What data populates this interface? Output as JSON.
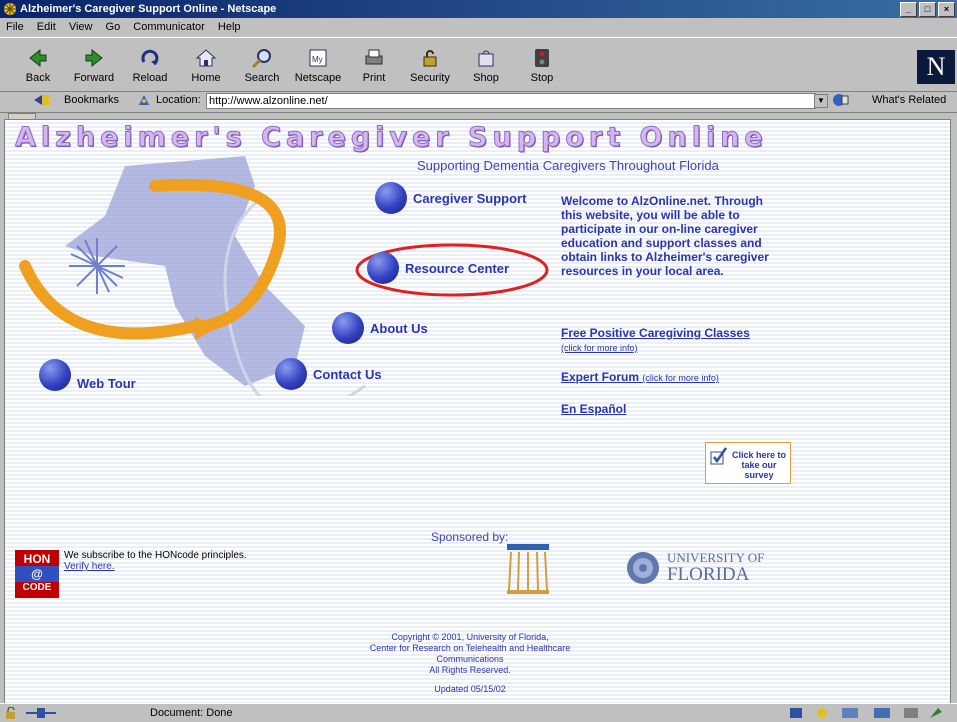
{
  "window": {
    "title": "Alzheimer's Caregiver Support Online - Netscape",
    "controls": {
      "minimize": "_",
      "maximize": "□",
      "close": "×"
    }
  },
  "menu": [
    "File",
    "Edit",
    "View",
    "Go",
    "Communicator",
    "Help"
  ],
  "toolbar": [
    {
      "label": "Back",
      "icon": "back-arrow-icon"
    },
    {
      "label": "Forward",
      "icon": "forward-arrow-icon"
    },
    {
      "label": "Reload",
      "icon": "reload-icon"
    },
    {
      "label": "Home",
      "icon": "home-icon"
    },
    {
      "label": "Search",
      "icon": "search-icon"
    },
    {
      "label": "Netscape",
      "icon": "netscape-icon"
    },
    {
      "label": "Print",
      "icon": "print-icon"
    },
    {
      "label": "Security",
      "icon": "lock-icon"
    },
    {
      "label": "Shop",
      "icon": "shop-icon"
    },
    {
      "label": "Stop",
      "icon": "stop-icon"
    }
  ],
  "location": {
    "bookmarks_label": "Bookmarks",
    "location_label": "Location:",
    "url": "http://www.alzonline.net/",
    "whats_related": "What's Related"
  },
  "page": {
    "site_title": "Alzheimer's Caregiver Support Online",
    "subtitle": "Supporting Dementia Caregivers Throughout Florida",
    "nav": {
      "caregiver_support": "Caregiver Support",
      "resource_center": "Resource Center",
      "about_us": "About Us",
      "contact_us": "Contact Us",
      "web_tour": "Web Tour"
    },
    "welcome": "Welcome to AlzOnline.net. Through this website, you will be able to participate in our on-line caregiver education and support classes and obtain links to Alzheimer's caregiver resources in your local area.",
    "links": {
      "classes": "Free Positive Caregiving Classes",
      "classes_note": "(click for more info)",
      "forum": "Expert Forum",
      "forum_note": "(click for more info)",
      "espanol": "En Español"
    },
    "survey": "Click here to take our survey",
    "sponsored_by": "Sponsored by:",
    "hon": {
      "logo_top": "HON",
      "logo_bottom": "CODE",
      "text": "We subscribe to the HONcode principles.",
      "verify": "Verify here."
    },
    "uf": {
      "line1": "UNIVERSITY OF",
      "line2": "FLORIDA"
    },
    "copyright": [
      "Copyright © 2001, University of Florida,",
      "Center for Research on Telehealth and Healthcare",
      "Communications",
      "All Rights Reserved."
    ],
    "updated": "Updated 05/15/02"
  },
  "status": "Document: Done"
}
